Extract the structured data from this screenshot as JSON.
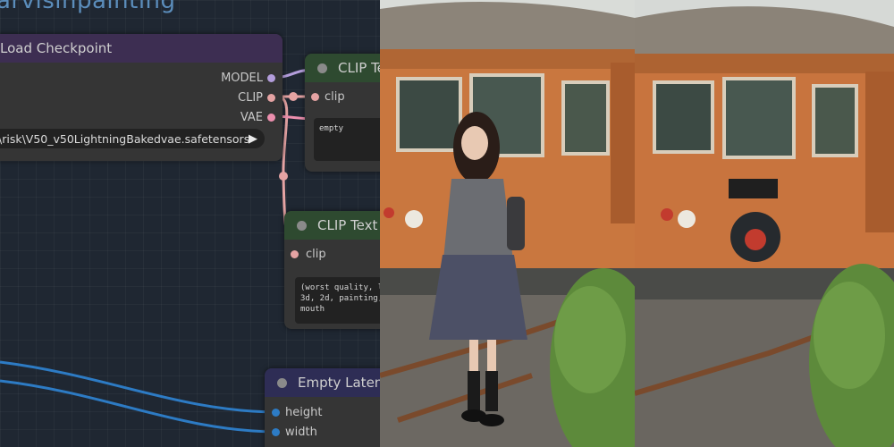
{
  "group": {
    "title": "arvisinpainting"
  },
  "nodes": {
    "load_checkpoint": {
      "title": "Load Checkpoint",
      "outputs": [
        "MODEL",
        "CLIP",
        "VAE"
      ],
      "ckpt_value": "\\risk\\V50_v50LightningBakedvae.safetensors"
    },
    "clip_text_top": {
      "title": "CLIP Te",
      "input": "clip",
      "text": "empty"
    },
    "clip_text_neg": {
      "title": "CLIP Text",
      "input": "clip",
      "text": "(worst quality, l\n3d, 2d, painting,\nmouth"
    },
    "empty_latent": {
      "title": "Empty Latent",
      "inputs": [
        "height",
        "width"
      ]
    }
  },
  "colors": {
    "group": "#5b8dbb",
    "checkpoint_header": "#3d2e52",
    "clip_header": "#2e4a30",
    "latent_header": "#2e2d55",
    "model_wire": "#b39ddb",
    "clip_wire": "#e5a3a3",
    "vae_wire": "#ec8fae",
    "int_wire": "#2d7bc4"
  },
  "icons": {
    "combo_arrow": "play-triangle-icon",
    "node_dot": "collapse-dot-icon"
  }
}
